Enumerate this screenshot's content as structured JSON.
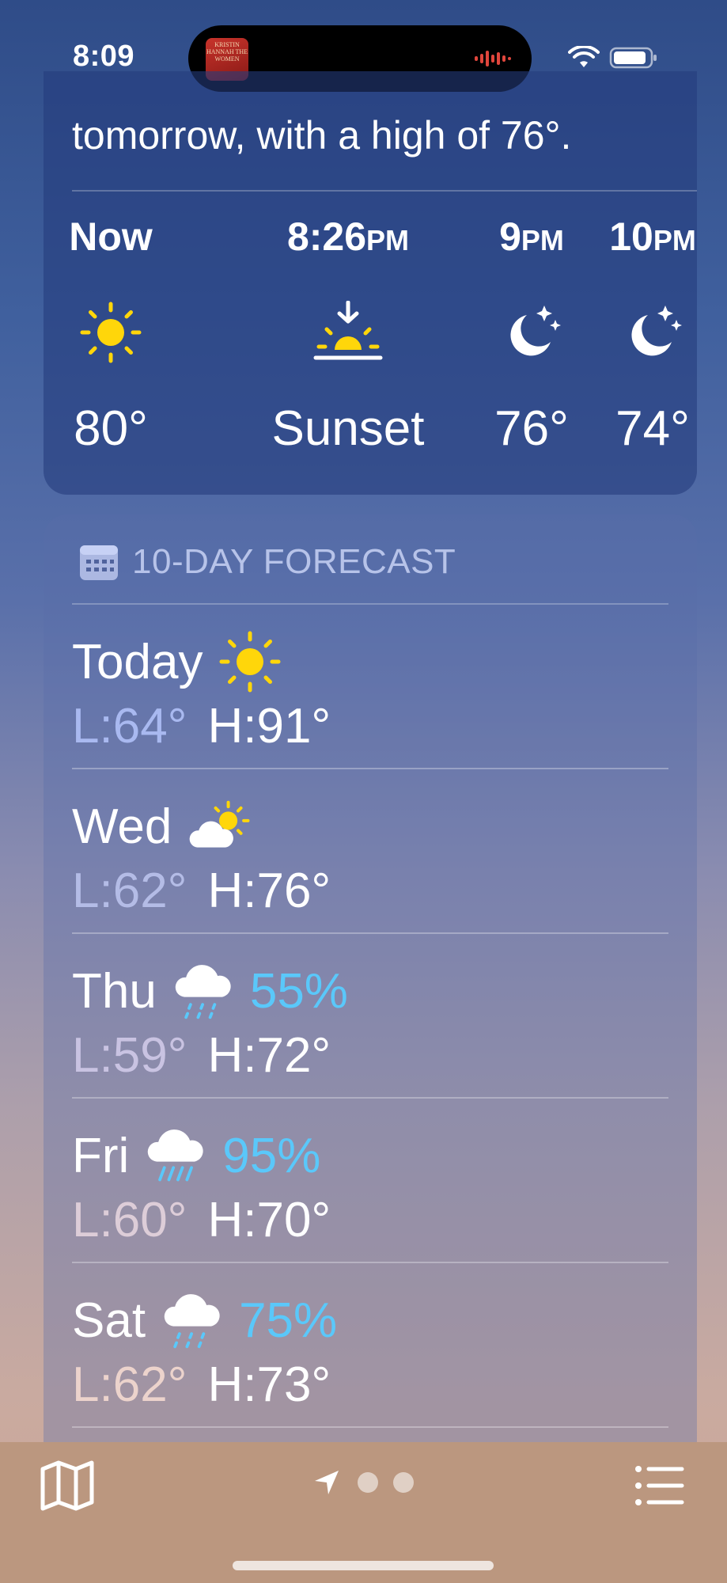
{
  "status_bar": {
    "time": "8:09",
    "album_art_text": "KRISTIN HANNAH THE WOMEN"
  },
  "hourly": {
    "summary": "tomorrow, with a high of 76°.",
    "items": [
      {
        "time": "Now",
        "suffix": "",
        "icon": "sun-icon",
        "value": "80°"
      },
      {
        "time": "8:26",
        "suffix": "PM",
        "icon": "sunset-icon",
        "value": "Sunset"
      },
      {
        "time": "9",
        "suffix": "PM",
        "icon": "moon-stars-icon",
        "value": "76°"
      },
      {
        "time": "10",
        "suffix": "PM",
        "icon": "moon-stars-icon",
        "value": "74°"
      }
    ]
  },
  "forecast": {
    "header": "10-DAY FORECAST",
    "days": [
      {
        "day": "Today",
        "icon": "sun-icon",
        "precip": "",
        "low": "L:64°",
        "high": "H:91°",
        "low_color": "#a9b9f0"
      },
      {
        "day": "Wed",
        "icon": "partly-cloudy-icon",
        "precip": "",
        "low": "L:62°",
        "high": "H:76°",
        "low_color": "#b4bce6"
      },
      {
        "day": "Thu",
        "icon": "cloud-drizzle-icon",
        "precip": "55%",
        "low": "L:59°",
        "high": "H:72°",
        "low_color": "#c9c3e2"
      },
      {
        "day": "Fri",
        "icon": "cloud-rain-icon",
        "precip": "95%",
        "low": "L:60°",
        "high": "H:70°",
        "low_color": "#ddcdd8"
      },
      {
        "day": "Sat",
        "icon": "cloud-drizzle-icon",
        "precip": "75%",
        "low": "L:62°",
        "high": "H:73°",
        "low_color": "#ecd3cc"
      }
    ]
  },
  "colors": {
    "sun": "#ffd60a",
    "precip": "#5ac8fa"
  }
}
